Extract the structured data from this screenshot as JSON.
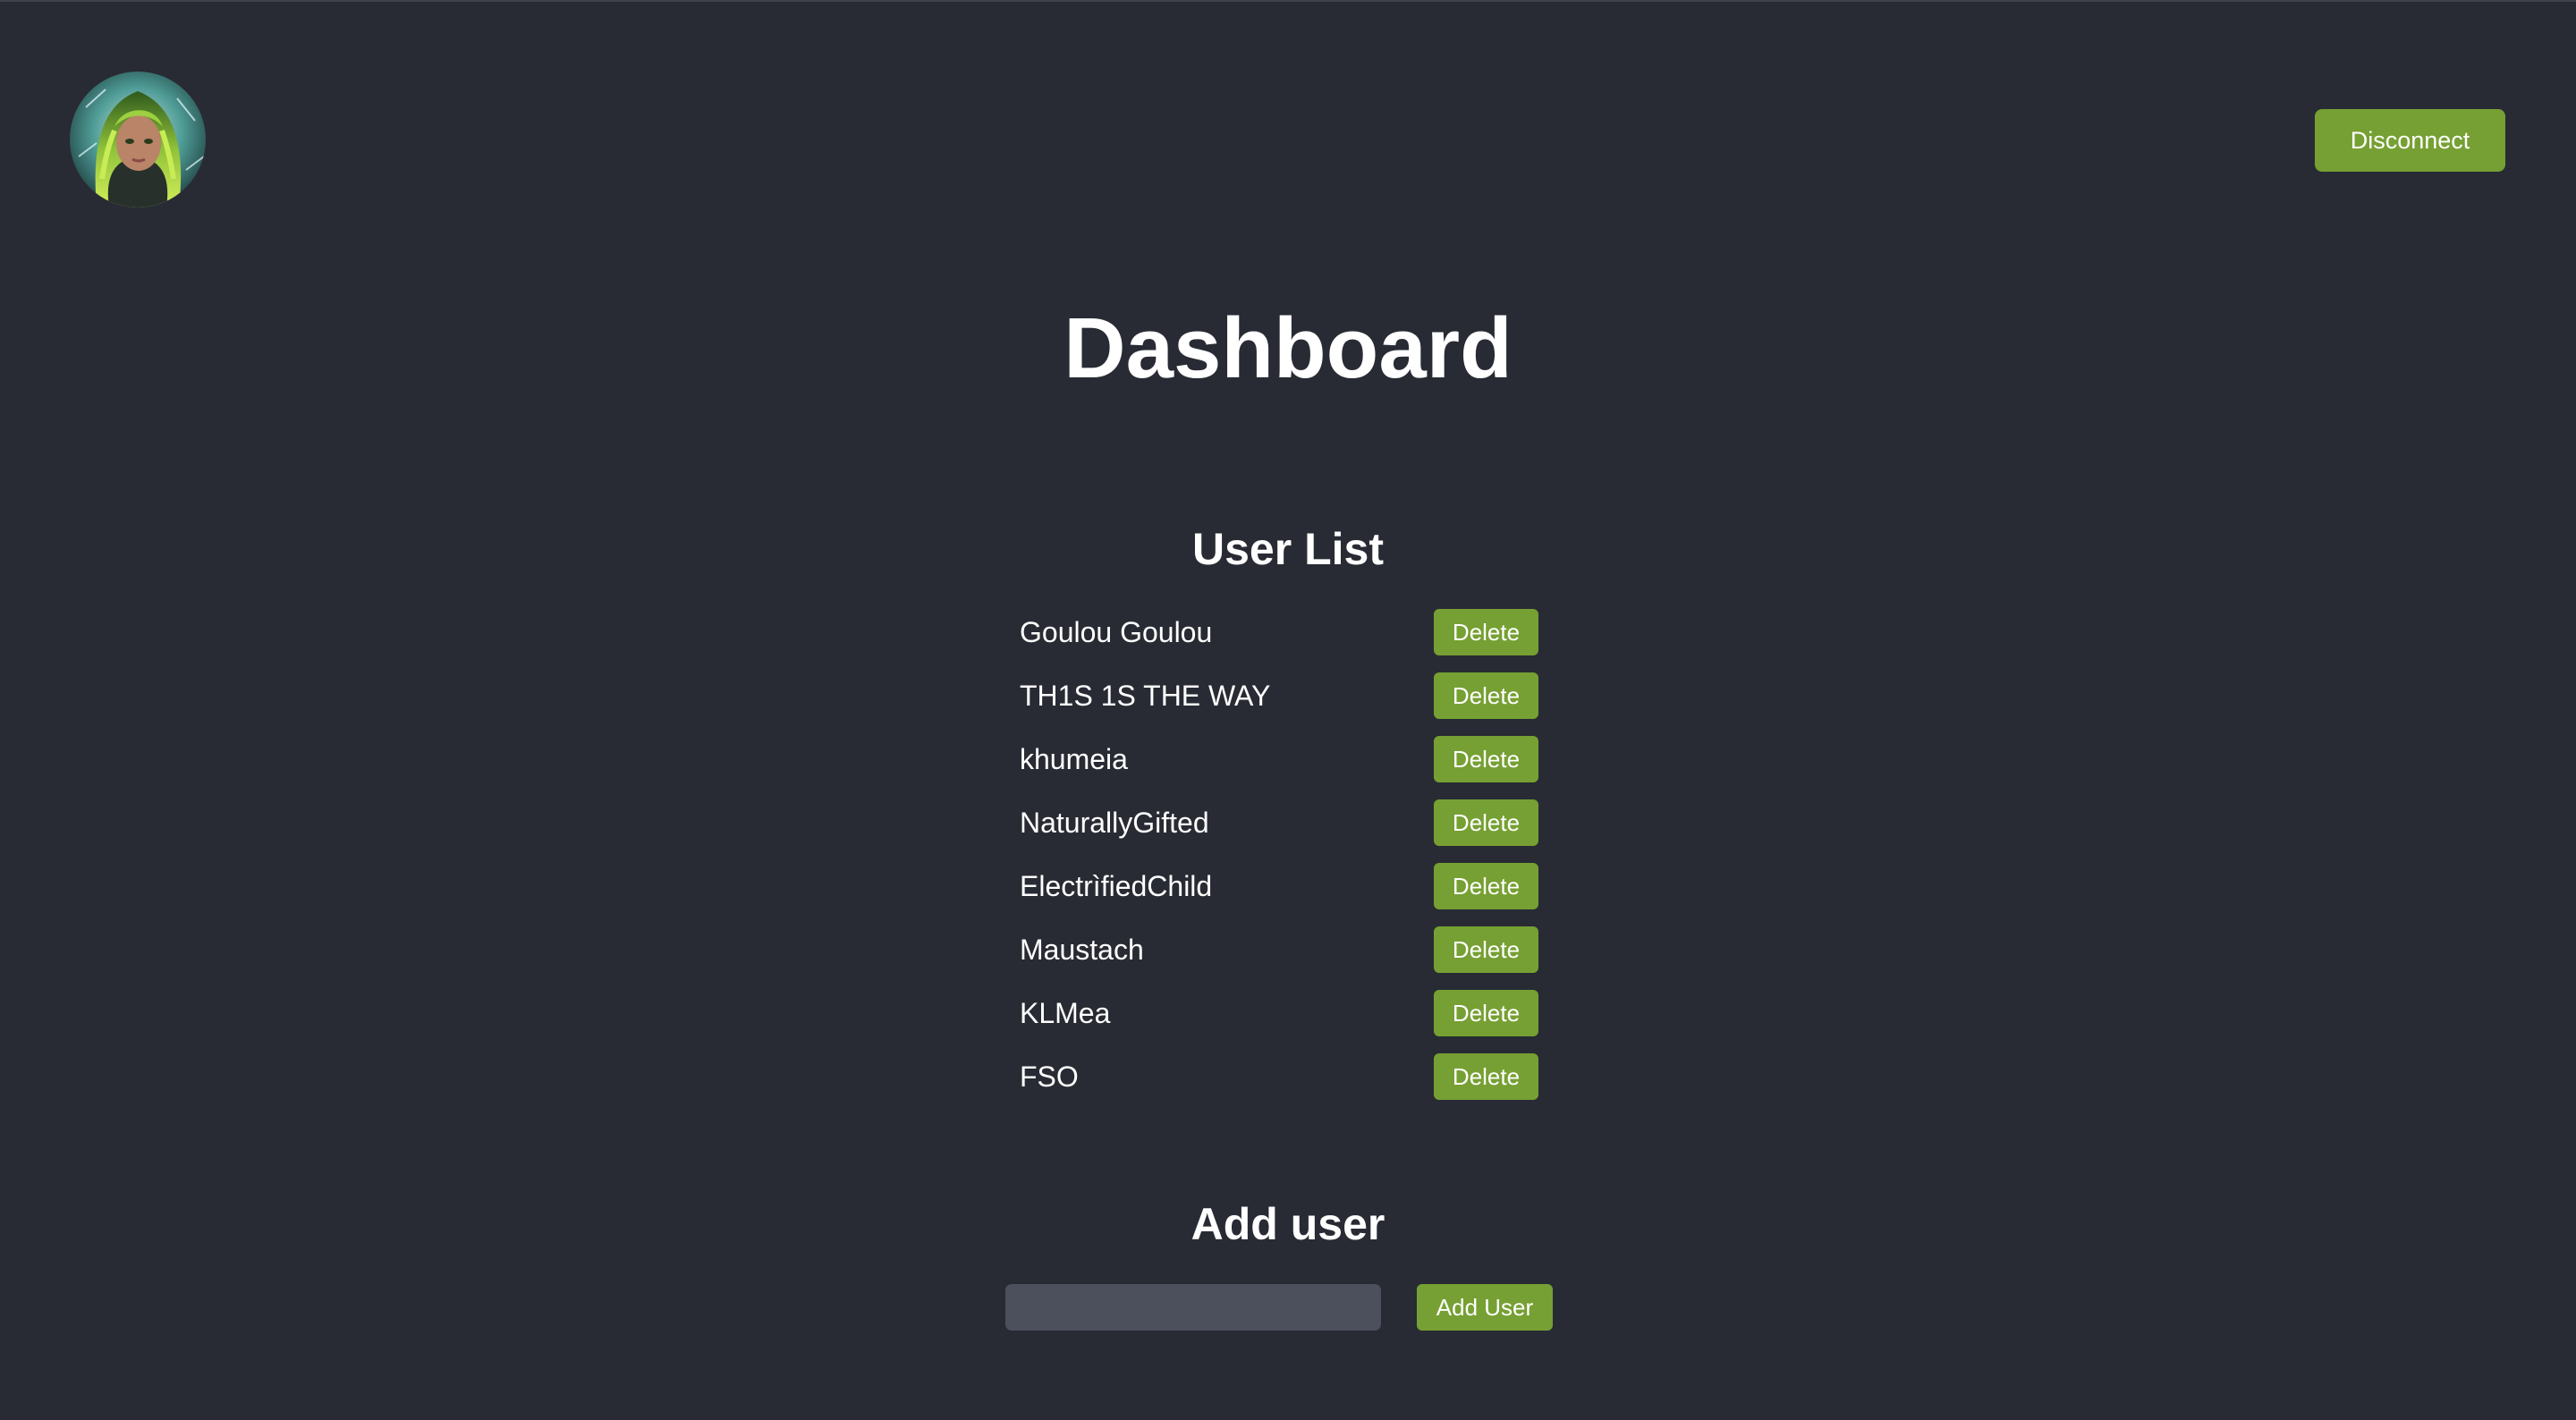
{
  "header": {
    "disconnect_label": "Disconnect"
  },
  "page_title": "Dashboard",
  "user_list": {
    "title": "User List",
    "delete_label": "Delete",
    "users": [
      {
        "name": "Goulou Goulou"
      },
      {
        "name": "TH1S 1S THE WAY"
      },
      {
        "name": "khumeia"
      },
      {
        "name": "NaturallyGifted"
      },
      {
        "name": "ElectrìfiedChild"
      },
      {
        "name": "Maustach"
      },
      {
        "name": "KLMea"
      },
      {
        "name": "FSO"
      }
    ]
  },
  "add_user": {
    "title": "Add user",
    "input_value": "",
    "button_label": "Add User"
  },
  "colors": {
    "background": "#282b33",
    "accent": "#76a033",
    "input_background": "#4c505d",
    "text": "#ffffff"
  }
}
